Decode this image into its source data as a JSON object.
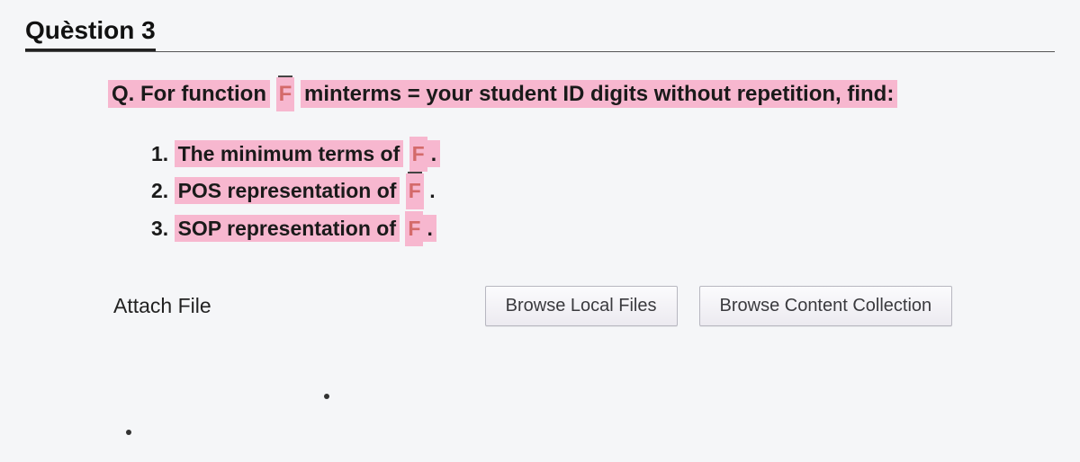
{
  "header": {
    "title": "Quèstion 3"
  },
  "prompt": {
    "prefix": "Q. For function",
    "f_symbol": "F",
    "mid": "minterms = your student ID digits without repetition, find:"
  },
  "list": {
    "items": [
      {
        "num": "1.",
        "text": "The minimum terms of",
        "f": "F",
        "tail": "."
      },
      {
        "num": "2.",
        "text": "POS representation of",
        "f": "F",
        "tail": " ."
      },
      {
        "num": "3.",
        "text": "SOP representation of",
        "f": "F",
        "tail": "."
      }
    ]
  },
  "attach": {
    "label": "Attach File",
    "browse_local": "Browse Local Files",
    "browse_collection": "Browse Content Collection"
  }
}
